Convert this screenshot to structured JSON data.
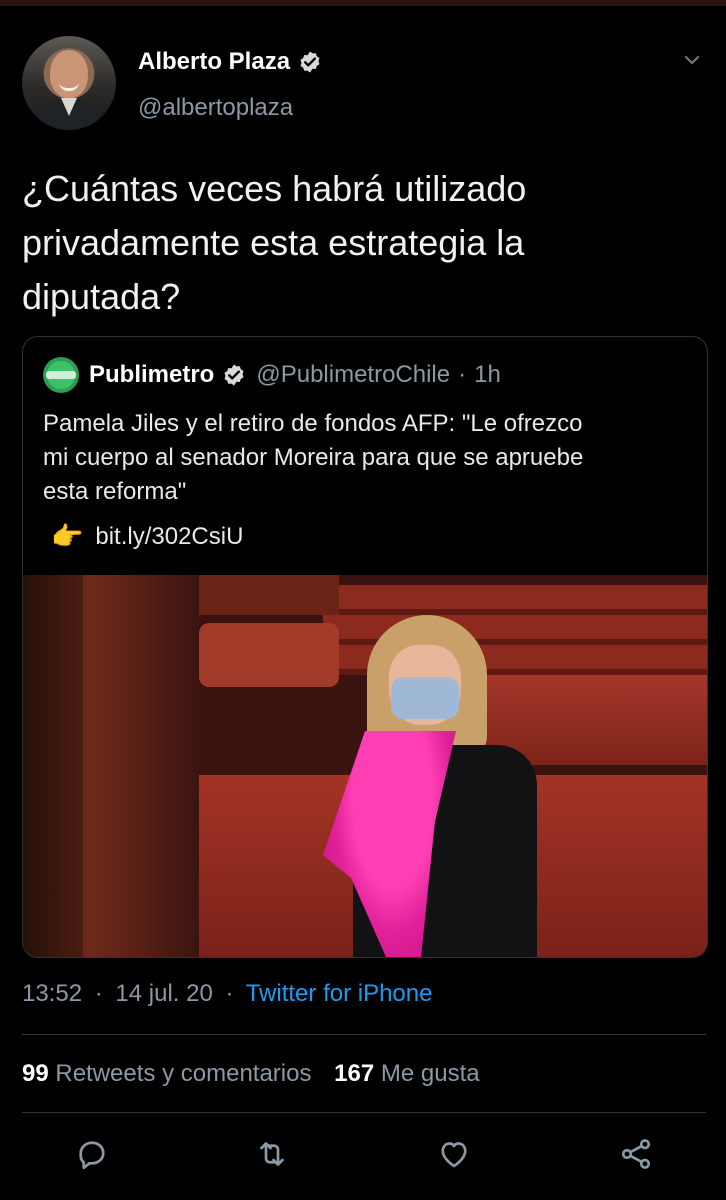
{
  "tweet": {
    "author": {
      "display_name": "Alberto Plaza",
      "handle": "@albertoplaza",
      "verified": true,
      "avatar_icon": "avatar"
    },
    "text": "¿Cuántas veces habrá utilizado\nprivadamente esta estrategia la\ndiputada?",
    "quoted": {
      "name": "Publimetro",
      "handle": "@PublimetroChile",
      "separator": "·",
      "time": "1h",
      "text": "Pamela Jiles y el retiro de fondos AFP: \"Le ofrezco\nmi cuerpo al senador Moreira para que se apruebe\nesta reforma\"",
      "link_icon": "👉",
      "link": "bit.ly/302CsiU"
    },
    "meta": {
      "time": "13:52",
      "sep1": "·",
      "date": "14 jul. 20",
      "sep2": "·",
      "source": "Twitter for iPhone"
    },
    "stats": {
      "retweets_count": "99",
      "retweets_label": "Retweets y comentarios",
      "likes_count": "167",
      "likes_label": "Me gusta"
    }
  },
  "colors": {
    "background": "#000000",
    "link": "#1d9bf0",
    "muted": "#8b98a5",
    "divider": "#2f3336"
  }
}
